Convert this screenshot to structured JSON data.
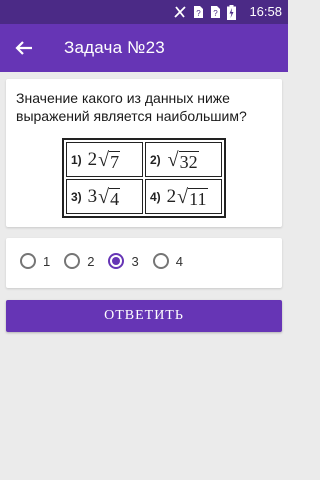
{
  "status_bar": {
    "time": "16:58"
  },
  "app_bar": {
    "title": "Задача №23"
  },
  "question": {
    "text": "Значение какого из данных ниже выражений является наибольшим?",
    "options": [
      {
        "num": "1)",
        "coef": "2",
        "radicand": "7"
      },
      {
        "num": "2)",
        "coef": "",
        "radicand": "32"
      },
      {
        "num": "3)",
        "coef": "3",
        "radicand": "4"
      },
      {
        "num": "4)",
        "coef": "2",
        "radicand": "11"
      }
    ]
  },
  "answers": {
    "choices": [
      "1",
      "2",
      "3",
      "4"
    ],
    "selected": "3"
  },
  "submit": {
    "label": "ОТВЕТИТЬ"
  },
  "colors": {
    "primary": "#6635b5",
    "status_bar": "#4b2a86",
    "background": "#ebebeb"
  }
}
